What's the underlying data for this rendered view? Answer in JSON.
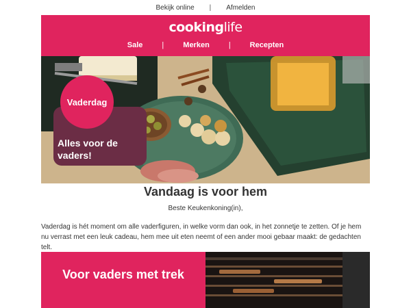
{
  "topbar": {
    "view_online": "Bekijk online",
    "separator": "|",
    "unsubscribe": "Afmelden"
  },
  "header": {
    "logo_bold": "cooking",
    "logo_light": "life",
    "nav": [
      {
        "label": "Sale"
      },
      {
        "label": "Merken"
      },
      {
        "label": "Recepten"
      }
    ],
    "nav_separator": "|"
  },
  "hero": {
    "badge": "Vaderdag",
    "tagline": "Alles voor de vaders!"
  },
  "main": {
    "title": "Vandaag is voor hem",
    "greeting": "Beste Keukenkoning(in),",
    "body": "Vaderdag is hét moment om alle vaderfiguren, in welke vorm dan ook, in het zonnetje te zetten. Of je hem nu verrast met een leuk cadeau, hem mee uit eten neemt of een ander mooi gebaar maakt: de gedachten telt."
  },
  "promo": {
    "text": "Voor vaders met trek"
  },
  "colors": {
    "brand": "#e0245e",
    "tag_bg": "#6b2d45"
  }
}
